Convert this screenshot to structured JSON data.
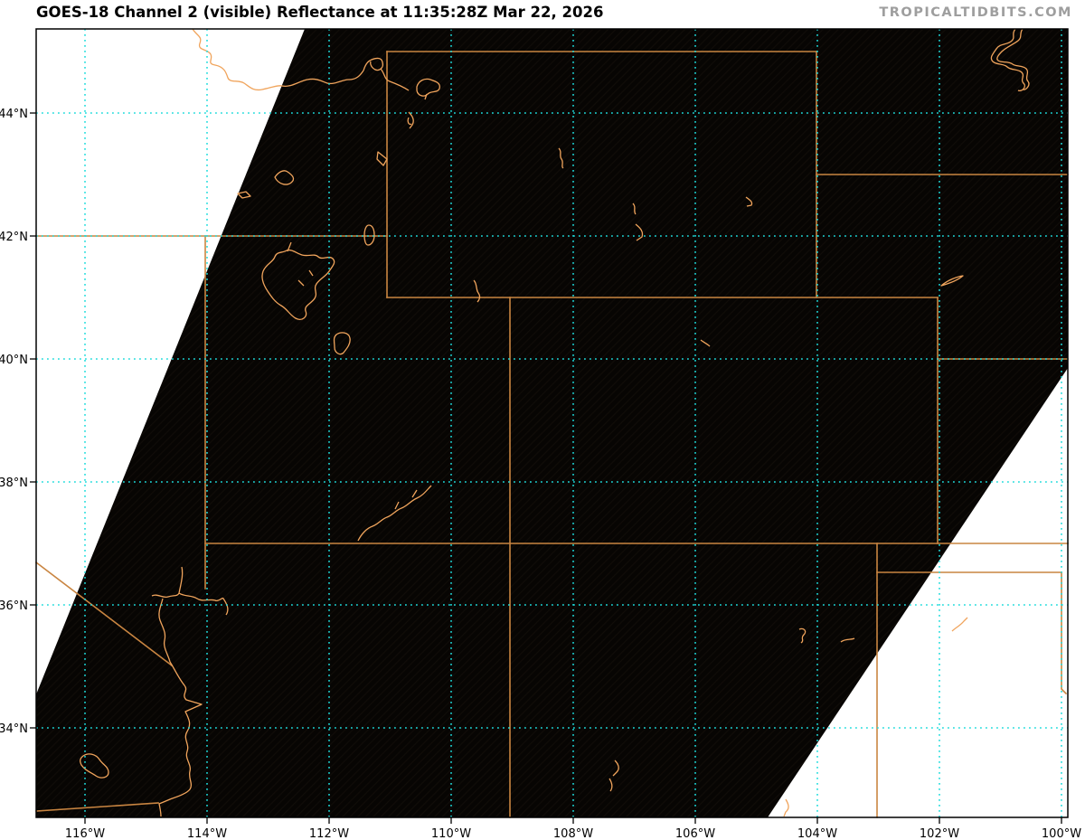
{
  "header": {
    "title": "GOES-18 Channel 2 (visible) Reflectance at 11:35:28Z Mar 22, 2026",
    "watermark": "TROPICALTIDBITS.COM",
    "satellite": "GOES-18",
    "channel": "Channel 2 (visible)",
    "product": "Reflectance",
    "valid_time": "11:35:28Z Mar 22, 2026"
  },
  "axes": {
    "lat_labels": [
      "44°N",
      "42°N",
      "40°N",
      "38°N",
      "36°N",
      "34°N"
    ],
    "lon_labels": [
      "116°W",
      "114°W",
      "112°W",
      "110°W",
      "108°W",
      "106°W",
      "104°W",
      "102°W",
      "100°W"
    ],
    "lat_gridlines_deg": [
      44,
      42,
      40,
      38,
      36,
      34
    ],
    "lon_gridlines_deg": [
      116,
      114,
      112,
      110,
      108,
      106,
      104,
      102,
      100
    ]
  },
  "map": {
    "imagery": "nighttime visible (near-black scene)",
    "no_data_regions": "white wedges at top-left and bottom-right (scan edge)",
    "features": [
      "state borders",
      "US-Mexico border",
      "rivers",
      "lakes and reservoirs"
    ],
    "colors": {
      "scene_black": "#070503",
      "no_data_white": "#ffffff",
      "border_orange": "#c98541",
      "water_orange": "#f0a45c",
      "grid_cyan": "#1edcdc",
      "frame_black": "#000000",
      "watermark_gray": "#9e9e9e"
    }
  }
}
